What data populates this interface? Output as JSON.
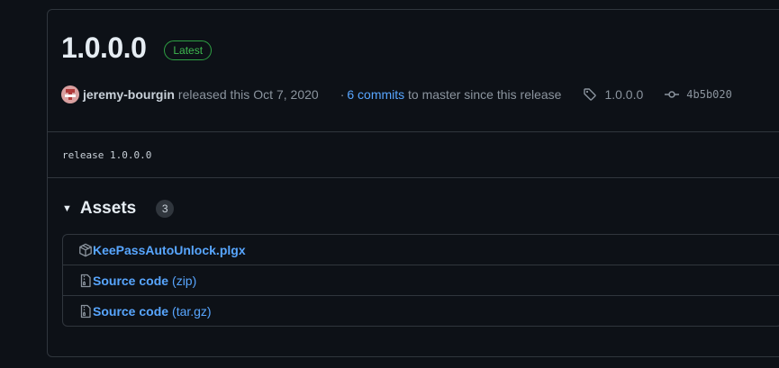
{
  "release": {
    "version": "1.0.0.0",
    "badge": "Latest",
    "author": "jeremy-bourgin",
    "released_text": "released this",
    "date": "Oct 7, 2020",
    "commits_dot": "·",
    "commits_link": "6 commits",
    "commits_suffix": "to master since this release",
    "tag": "1.0.0.0",
    "commit_hash": "4b5b020",
    "body": "release 1.0.0.0"
  },
  "assets": {
    "title": "Assets",
    "count": "3",
    "items": [
      {
        "name": "KeePassAutoUnlock.plgx",
        "ext": "",
        "icon": "package-icon"
      },
      {
        "name": "Source code",
        "ext": "(zip)",
        "icon": "file-zip-icon"
      },
      {
        "name": "Source code",
        "ext": "(tar.gz)",
        "icon": "file-zip-icon"
      }
    ]
  },
  "colors": {
    "background": "#0d1117",
    "border": "#30363d",
    "link": "#58a6ff",
    "latest_green": "#3fb950"
  }
}
